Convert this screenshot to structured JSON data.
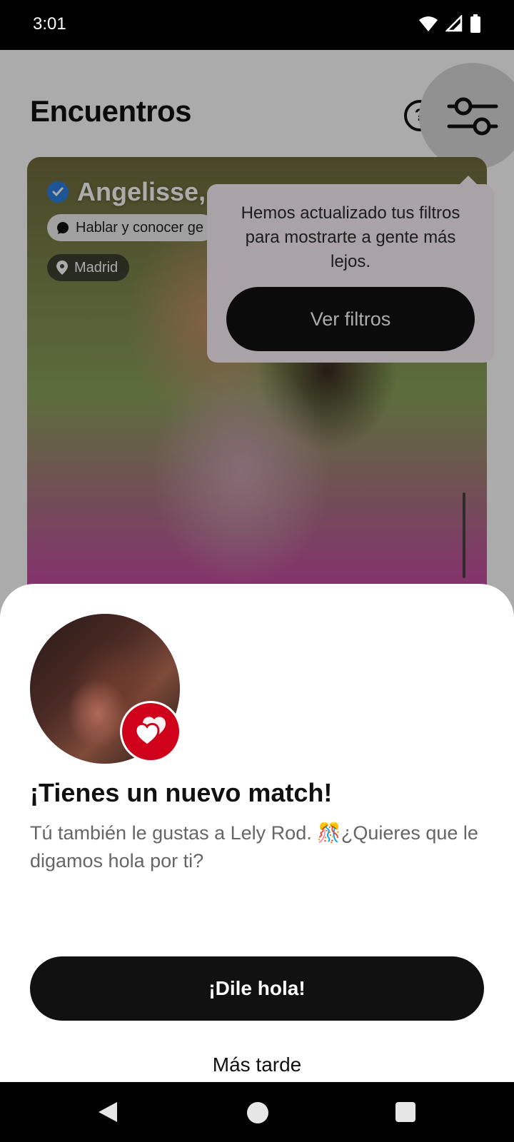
{
  "status_bar": {
    "time": "3:01"
  },
  "header": {
    "title": "Encuentros",
    "help_icon": "?"
  },
  "card": {
    "name": "Angelisse,",
    "intent": "Hablar y conocer ge",
    "location": "Madrid"
  },
  "tooltip": {
    "text": "Hemos actualizado tus filtros para mostrarte a gente más lejos.",
    "button_label": "Ver filtros"
  },
  "match_sheet": {
    "title": "¡Tienes un nuevo match!",
    "body": "Tú también le gustas a Lely Rod. 🎊¿Quieres que le digamos hola por ti?",
    "primary_label": "¡Dile hola!",
    "secondary_label": "Más tarde"
  },
  "colors": {
    "accent": "#d0021b",
    "button_dark": "#111111",
    "tooltip_bg": "#fdf4fb",
    "verified": "#2d7fe0"
  }
}
